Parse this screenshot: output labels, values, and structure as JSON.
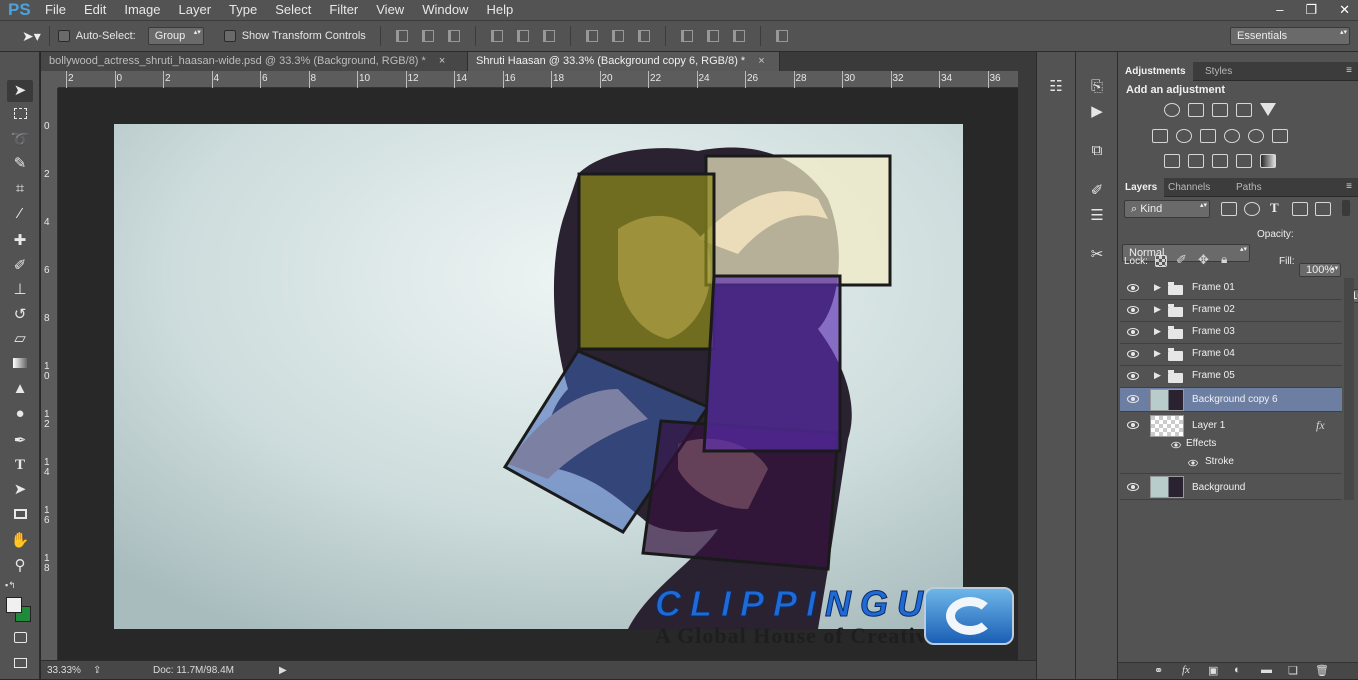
{
  "app": {
    "logo": "PS"
  },
  "menu": {
    "items": [
      "File",
      "Edit",
      "Image",
      "Layer",
      "Type",
      "Select",
      "Filter",
      "View",
      "Window",
      "Help"
    ]
  },
  "window_controls": {
    "minimize": "–",
    "restore": "❐",
    "close": "✕"
  },
  "options": {
    "auto_select_label": "Auto-Select:",
    "auto_select_value": "Group",
    "show_transform_label": "Show Transform Controls",
    "workspace": "Essentials"
  },
  "documents": {
    "tabs": [
      {
        "title": "bollywood_actress_shruti_haasan-wide.psd @ 33.3% (Background, RGB/8) *",
        "active": false
      },
      {
        "title": "Shruti Haasan @ 33.3% (Background copy 6, RGB/8) *",
        "active": true
      }
    ],
    "close_glyph": "×"
  },
  "rulers": {
    "horizontal": [
      "2",
      "0",
      "2",
      "4",
      "6",
      "8",
      "10",
      "12",
      "14",
      "16",
      "18",
      "20",
      "22",
      "24",
      "26",
      "28",
      "30",
      "32",
      "34",
      "36"
    ],
    "vertical": [
      "0",
      "2",
      "4",
      "6",
      "8",
      "1 0",
      "1 2",
      "1 4",
      "1 6",
      "1 8"
    ]
  },
  "canvas": {
    "colors": {
      "frame_yellow": "#8c8a1c",
      "frame_purple": "#5a2db0",
      "frame_cream": "#f3ecc4",
      "frame_blue": "#3d63b8",
      "frame_dark": "#35113d",
      "background": "#dde8e8"
    },
    "watermark": {
      "brand": "CLIPPINGUSA",
      "tagline": "A Global House of Creative Needs",
      "brand_color": "#1f6bd6",
      "accent_color": "#e03a2c"
    }
  },
  "status": {
    "zoom": "33.33%",
    "doc_info": "Doc: 11.7M/98.4M"
  },
  "adjustments": {
    "tabs": [
      "Adjustments",
      "Styles"
    ],
    "heading": "Add an adjustment"
  },
  "layers_panel": {
    "tabs": [
      "Layers",
      "Channels",
      "Paths"
    ],
    "filter_kind": "Kind",
    "blend_mode": "Normal",
    "opacity_label": "Opacity:",
    "opacity_value": "100%",
    "lock_label": "Lock:",
    "fill_label": "Fill:",
    "fill_value": "100%",
    "layers": [
      {
        "name": "Frame 01",
        "type": "group"
      },
      {
        "name": "Frame 02",
        "type": "group"
      },
      {
        "name": "Frame 03",
        "type": "group"
      },
      {
        "name": "Frame 04",
        "type": "group"
      },
      {
        "name": "Frame 05",
        "type": "group"
      },
      {
        "name": "Background copy 6",
        "type": "image",
        "selected": true
      },
      {
        "name": "Layer 1",
        "type": "empty",
        "fx": "fx",
        "effects_label": "Effects",
        "effect": "Stroke"
      },
      {
        "name": "Background",
        "type": "image"
      }
    ]
  }
}
